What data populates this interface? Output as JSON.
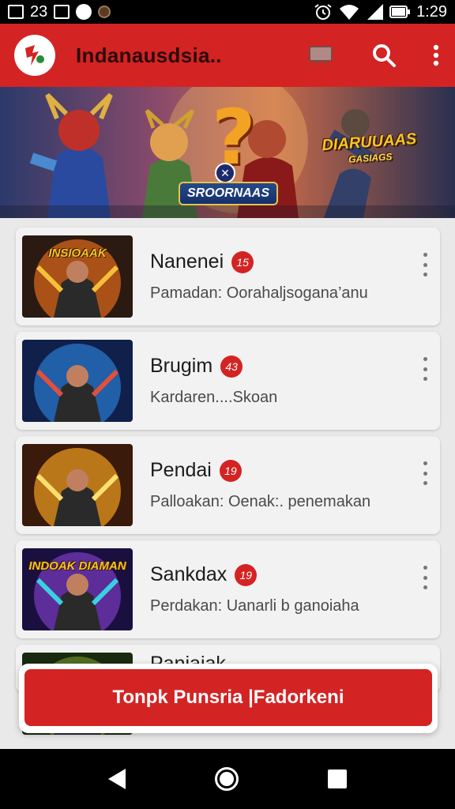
{
  "status_bar": {
    "notification_count": "23",
    "time": "1:29",
    "icons": [
      "image-icon",
      "image-icon",
      "clock-icon",
      "app-icon",
      "alarm-icon",
      "wifi-icon",
      "signal-icon",
      "battery-icon"
    ]
  },
  "app_bar": {
    "title": "Indanausdsia..",
    "icons": [
      "app-logo",
      "cast-icon",
      "search-icon",
      "more-vert-icon"
    ]
  },
  "banner": {
    "title": "DIARUUAAS",
    "subtitle": "GASIAGS",
    "label": "SROORNAAS",
    "question_mark": "?",
    "close_glyph": "✕"
  },
  "list": {
    "items": [
      {
        "title": "Nanenei",
        "badge": "15",
        "subtitle": "Pamadan: Oorahaljsogana’anu",
        "thumb_text": "INSIOAAK",
        "thumb_theme": "orange"
      },
      {
        "title": "Brugim",
        "badge": "43",
        "subtitle": "Kardaren....Skoan",
        "thumb_text": "",
        "thumb_theme": "blue"
      },
      {
        "title": "Pendai",
        "badge": "19",
        "subtitle": "Palloakan: Oenak:. penemakan",
        "thumb_text": "",
        "thumb_theme": "gold"
      },
      {
        "title": "Sankdax",
        "badge": "19",
        "subtitle": "Perdakan: Uanarli b ganoiaha",
        "thumb_text": "INDOAK DIAMAN",
        "thumb_theme": "purple"
      },
      {
        "title": "Paniaiak",
        "badge": "",
        "subtitle": "",
        "thumb_text": "",
        "thumb_theme": "green"
      }
    ]
  },
  "cta": {
    "label": "Tonpk Punsria |Fadorkeni"
  },
  "colors": {
    "primary": "#d42323",
    "card": "#f2f2f2",
    "background": "#e9e9e9"
  }
}
